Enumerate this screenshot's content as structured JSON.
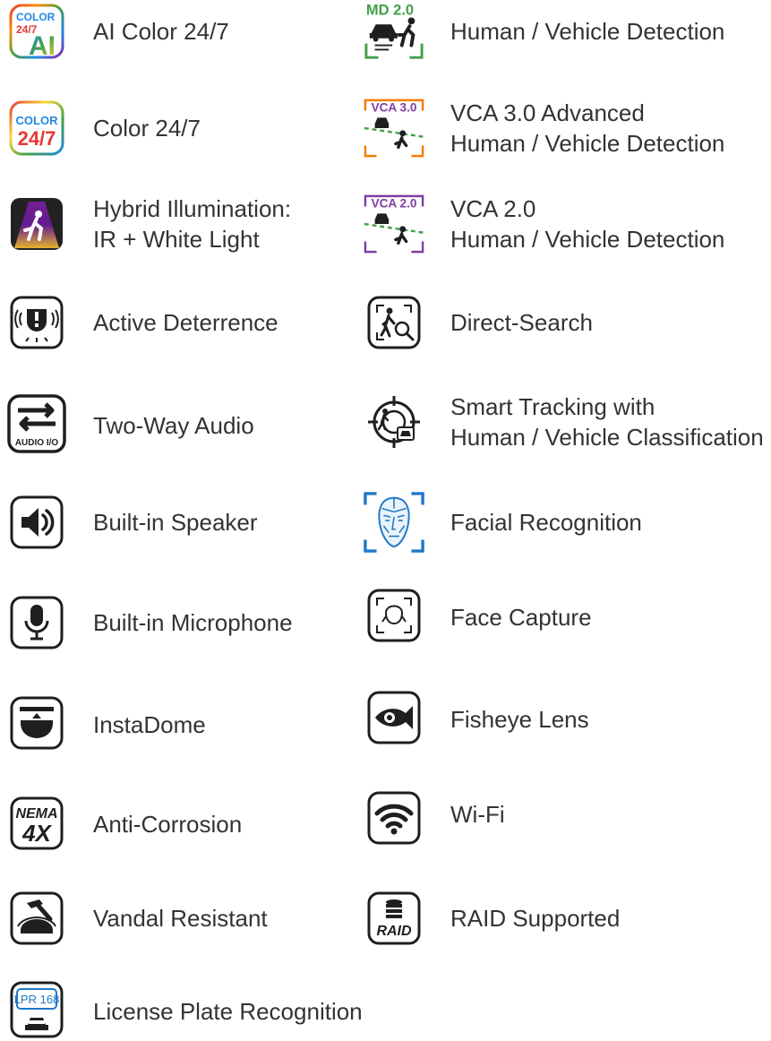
{
  "colors": {
    "text": "#333333",
    "icon_dark": "#1f1f1f",
    "ai_blue": "#1e88e5",
    "md_green": "#43a047",
    "vca3_orange": "#f57c00",
    "vca2_purple": "#7e3fa3",
    "face_blue": "#1f78c8",
    "lpr_blue": "#1f78c8"
  },
  "icon_text": {
    "ai_color_top": "COLOR",
    "ai_color_mid": "24/7",
    "ai_color_ai": "AI",
    "color_top": "COLOR",
    "color_mid": "24/7",
    "audio_io": "AUDIO I/O",
    "nema_top": "NEMA",
    "nema_bottom": "4X",
    "lpr": "LPR 168",
    "md": "MD 2.0",
    "vca3": "VCA 3.0",
    "vca2": "VCA 2.0",
    "raid": "RAID"
  },
  "features_left": [
    {
      "icon": "ai-color-icon",
      "lines": [
        "AI Color 24/7"
      ]
    },
    {
      "icon": "color-24-7-icon",
      "lines": [
        "Color 24/7"
      ]
    },
    {
      "icon": "hybrid-illumination-icon",
      "lines": [
        "Hybrid Illumination:",
        "IR + White Light"
      ]
    },
    {
      "icon": "active-deterrence-icon",
      "lines": [
        "Active Deterrence"
      ]
    },
    {
      "icon": "two-way-audio-icon",
      "lines": [
        "Two-Way Audio"
      ]
    },
    {
      "icon": "speaker-icon",
      "lines": [
        "Built-in Speaker"
      ]
    },
    {
      "icon": "microphone-icon",
      "lines": [
        "Built-in Microphone"
      ]
    },
    {
      "icon": "instadome-icon",
      "lines": [
        "InstaDome"
      ]
    },
    {
      "icon": "nema-4x-icon",
      "lines": [
        "Anti-Corrosion"
      ]
    },
    {
      "icon": "vandal-resistant-icon",
      "lines": [
        "Vandal Resistant"
      ]
    },
    {
      "icon": "lpr-icon",
      "lines": [
        "License Plate Recognition"
      ]
    }
  ],
  "features_right": [
    {
      "icon": "md-2-icon",
      "lines": [
        "Human / Vehicle Detection"
      ]
    },
    {
      "icon": "vca-3-icon",
      "lines": [
        "VCA 3.0 Advanced",
        "Human / Vehicle Detection"
      ]
    },
    {
      "icon": "vca-2-icon",
      "lines": [
        "VCA 2.0",
        "Human / Vehicle Detection"
      ]
    },
    {
      "icon": "direct-search-icon",
      "lines": [
        "Direct-Search"
      ]
    },
    {
      "icon": "smart-tracking-icon",
      "lines": [
        "Smart Tracking with",
        "Human / Vehicle Classification"
      ]
    },
    {
      "icon": "facial-recognition-icon",
      "lines": [
        "Facial Recognition"
      ]
    },
    {
      "icon": "face-capture-icon",
      "lines": [
        "Face Capture"
      ]
    },
    {
      "icon": "fisheye-icon",
      "lines": [
        "Fisheye Lens"
      ]
    },
    {
      "icon": "wifi-icon",
      "lines": [
        "Wi-Fi"
      ]
    },
    {
      "icon": "raid-icon",
      "lines": [
        "RAID Supported"
      ]
    }
  ]
}
